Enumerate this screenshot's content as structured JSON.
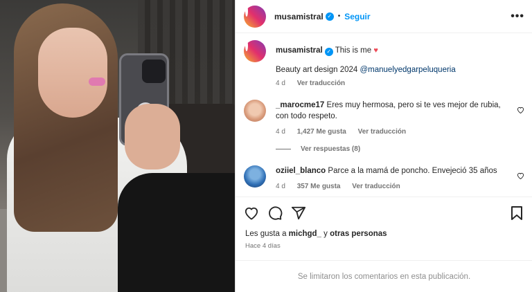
{
  "header": {
    "username": "musamistral",
    "verified_glyph": "✓",
    "separator": "•",
    "follow_label": "Seguir",
    "more_label": "•••"
  },
  "caption": {
    "username": "musamistral",
    "verified_glyph": "✓",
    "text": "This is me",
    "heart": "♥",
    "line2_prefix": "Beauty art design 2024 ",
    "mention": "@manuelyedgarpeluqueria",
    "time": "4 d",
    "translate": "Ver traducción"
  },
  "comments": [
    {
      "username": "_marocme17",
      "text": "Eres muy hermosa, pero si te ves mejor de rubia, con todo respeto.",
      "time": "4 d",
      "likes": "1,427 Me gusta",
      "translate": "Ver traducción",
      "replies": "Ver respuestas (8)"
    },
    {
      "username": "oziiel_blanco",
      "text": "Parce a la mamá de poncho. Envejeció 35 años",
      "time": "4 d",
      "likes": "357 Me gusta",
      "translate": "Ver traducción"
    }
  ],
  "actions": {
    "like_icon": "heart-outline-icon",
    "comment_icon": "comment-icon",
    "share_icon": "share-icon",
    "save_icon": "bookmark-icon"
  },
  "likes": {
    "prefix": "Les gusta a ",
    "user": "michgd_",
    "mid": " y ",
    "others": "otras personas"
  },
  "posted": "Hace 4 días",
  "comments_limited": "Se limitaron los comentarios en esta publicación.",
  "colors": {
    "accent": "#0095f6",
    "heart": "#ed4956",
    "muted": "#737373",
    "mention": "#00376b"
  }
}
